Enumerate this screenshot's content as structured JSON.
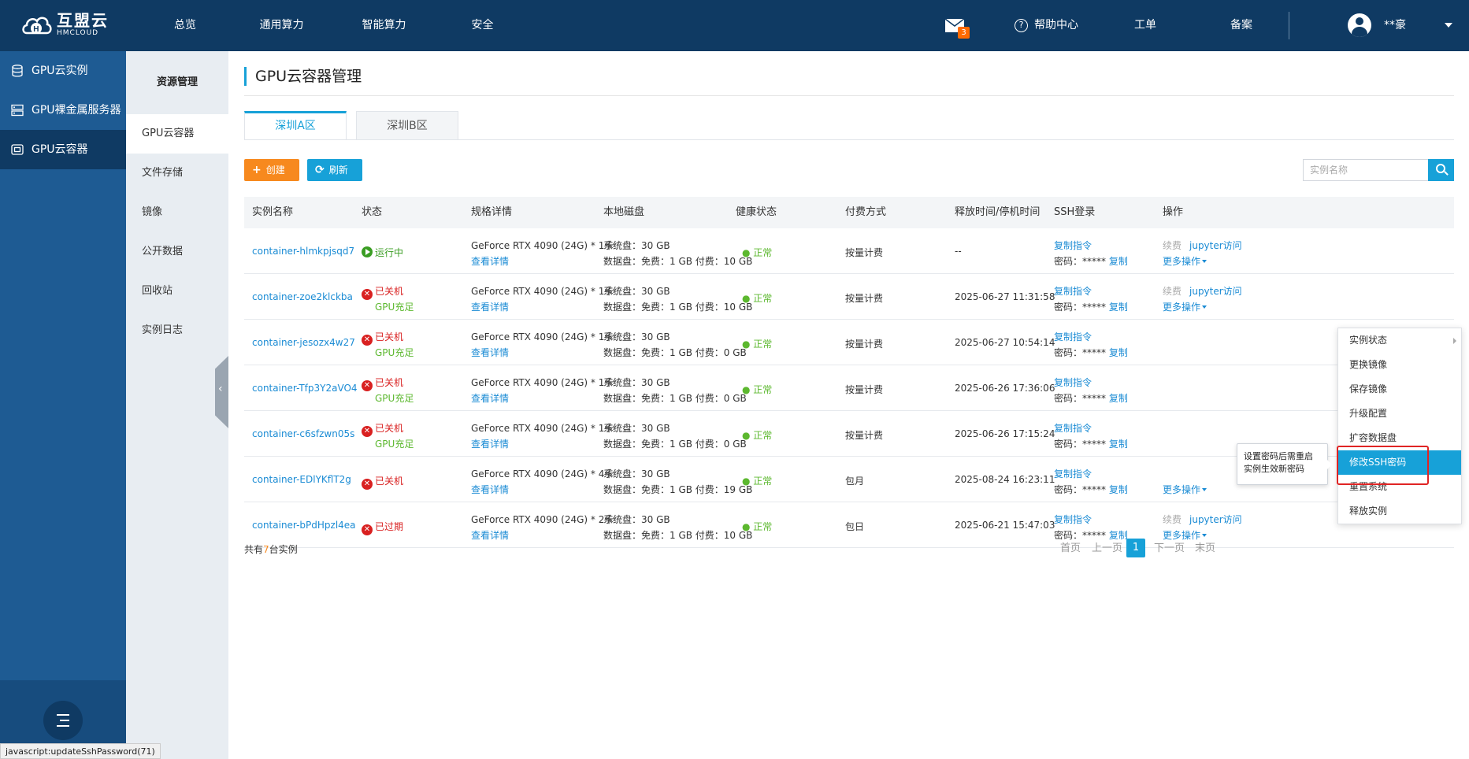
{
  "brand": {
    "name_cn": "互盟云",
    "name_en": "HMCLOUD"
  },
  "topnav": [
    "总览",
    "通用算力",
    "智能算力",
    "安全"
  ],
  "header": {
    "mail_count": "3",
    "help": "帮助中心",
    "ticket": "工单",
    "filing": "备案",
    "username": "**豪"
  },
  "sidebar": {
    "items": [
      "GPU云实例",
      "GPU裸金属服务器",
      "GPU云容器"
    ]
  },
  "subside": {
    "title": "资源管理",
    "items": [
      "GPU云容器",
      "文件存储",
      "镜像",
      "公开数据",
      "回收站",
      "实例日志"
    ]
  },
  "page": {
    "title": "GPU云容器管理"
  },
  "tabs": [
    "深圳A区",
    "深圳B区"
  ],
  "toolbar": {
    "create": "创建",
    "refresh": "刷新",
    "search_placeholder": "实例名称"
  },
  "table": {
    "headers": [
      "实例名称",
      "状态",
      "规格详情",
      "本地磁盘",
      "健康状态",
      "付费方式",
      "释放时间/停机时间",
      "SSH登录",
      "操作"
    ],
    "rows": [
      {
        "name": "container-hlmkpjsqd7",
        "status": "运行中",
        "status_type": "run",
        "status_sub": "",
        "spec": "GeForce RTX 4090 (24G) * 1卡",
        "spec_link": "查看详情",
        "sys_disk": "系统盘：30 GB",
        "data_disk": "数据盘：免费：1 GB 付费：10 GB",
        "health": "● 正常",
        "billing": "按量计费",
        "time": "--",
        "ssh_cmd": "复制指令",
        "ssh_pwd": "密码：*****",
        "ssh_copy": "复制",
        "op_renew": "续费",
        "op_jupyter": "jupyter访问",
        "op_more": "更多操作"
      },
      {
        "name": "container-zoe2klckba",
        "status": "已关机",
        "status_type": "x",
        "status_sub": "GPU充足",
        "spec": "GeForce RTX 4090 (24G) * 1卡",
        "spec_link": "查看详情",
        "sys_disk": "系统盘：30 GB",
        "data_disk": "数据盘：免费：1 GB 付费：10 GB",
        "health": "● 正常",
        "billing": "按量计费",
        "time": "2025-06-27 11:31:58",
        "ssh_cmd": "复制指令",
        "ssh_pwd": "密码：*****",
        "ssh_copy": "复制",
        "op_renew": "续费",
        "op_jupyter": "jupyter访问",
        "op_more": "更多操作"
      },
      {
        "name": "container-jesozx4w27",
        "status": "已关机",
        "status_type": "x",
        "status_sub": "GPU充足",
        "spec": "GeForce RTX 4090 (24G) * 1卡",
        "spec_link": "查看详情",
        "sys_disk": "系统盘：30 GB",
        "data_disk": "数据盘：免费：1 GB 付费：0 GB",
        "health": "● 正常",
        "billing": "按量计费",
        "time": "2025-06-27 10:54:14",
        "ssh_cmd": "复制指令",
        "ssh_pwd": "密码：*****",
        "ssh_copy": "复制",
        "op_renew": "",
        "op_jupyter": "",
        "op_more": ""
      },
      {
        "name": "container-Tfp3Y2aVO4",
        "status": "已关机",
        "status_type": "x",
        "status_sub": "GPU充足",
        "spec": "GeForce RTX 4090 (24G) * 1卡",
        "spec_link": "查看详情",
        "sys_disk": "系统盘：30 GB",
        "data_disk": "数据盘：免费：1 GB 付费：0 GB",
        "health": "● 正常",
        "billing": "按量计费",
        "time": "2025-06-26 17:36:06",
        "ssh_cmd": "复制指令",
        "ssh_pwd": "密码：*****",
        "ssh_copy": "复制",
        "op_renew": "",
        "op_jupyter": "",
        "op_more": ""
      },
      {
        "name": "container-c6sfzwn05s",
        "status": "已关机",
        "status_type": "x",
        "status_sub": "GPU充足",
        "spec": "GeForce RTX 4090 (24G) * 1卡",
        "spec_link": "查看详情",
        "sys_disk": "系统盘：30 GB",
        "data_disk": "数据盘：免费：1 GB 付费：0 GB",
        "health": "● 正常",
        "billing": "按量计费",
        "time": "2025-06-26 17:15:24",
        "ssh_cmd": "复制指令",
        "ssh_pwd": "密码：*****",
        "ssh_copy": "复制",
        "op_renew": "",
        "op_jupyter": "",
        "op_more": ""
      },
      {
        "name": "container-EDlYKflT2g",
        "status": "已关机",
        "status_type": "x",
        "status_sub": "",
        "spec": "GeForce RTX 4090 (24G) * 4卡",
        "spec_link": "查看详情",
        "sys_disk": "系统盘：30 GB",
        "data_disk": "数据盘：免费：1 GB 付费：19 GB",
        "health": "● 正常",
        "billing": "包月",
        "time": "2025-08-24 16:23:11",
        "ssh_cmd": "复制指令",
        "ssh_pwd": "密码：*****",
        "ssh_copy": "复制",
        "op_renew": "",
        "op_jupyter": "",
        "op_more": "更多操作"
      },
      {
        "name": "container-bPdHpzl4ea",
        "status": "已过期",
        "status_type": "x",
        "status_sub": "",
        "spec": "GeForce RTX 4090 (24G) * 2卡",
        "spec_link": "查看详情",
        "sys_disk": "系统盘：30 GB",
        "data_disk": "数据盘：免费：1 GB 付费：10 GB",
        "health": "● 正常",
        "billing": "包日",
        "time": "2025-06-21 15:47:03",
        "ssh_cmd": "复制指令",
        "ssh_pwd": "密码：*****",
        "ssh_copy": "复制",
        "op_renew": "续费",
        "op_jupyter": "jupyter访问",
        "op_more": "更多操作"
      }
    ]
  },
  "footer": {
    "count_prefix": "共有",
    "count": "7",
    "count_suffix": "台实例"
  },
  "pager": {
    "first": "首页",
    "prev": "上一页",
    "current": "1",
    "next": "下一页",
    "last": "末页"
  },
  "dropdown": {
    "items": [
      "实例状态",
      "更换镜像",
      "保存镜像",
      "升级配置",
      "扩容数据盘",
      "修改SSH密码",
      "重置系统",
      "释放实例"
    ],
    "active_index": 5
  },
  "tooltip": {
    "line1": "设置密码后需重启",
    "line2": "实例生效新密码"
  },
  "statusbar": "javascript:updateSshPassword(71)",
  "colors": {
    "topbar": "#0f3a63",
    "sidebar": "#1e5b93",
    "accent": "#17a1d8",
    "create": "#f7891e",
    "danger": "#d92020",
    "ok": "#5cb82f"
  }
}
